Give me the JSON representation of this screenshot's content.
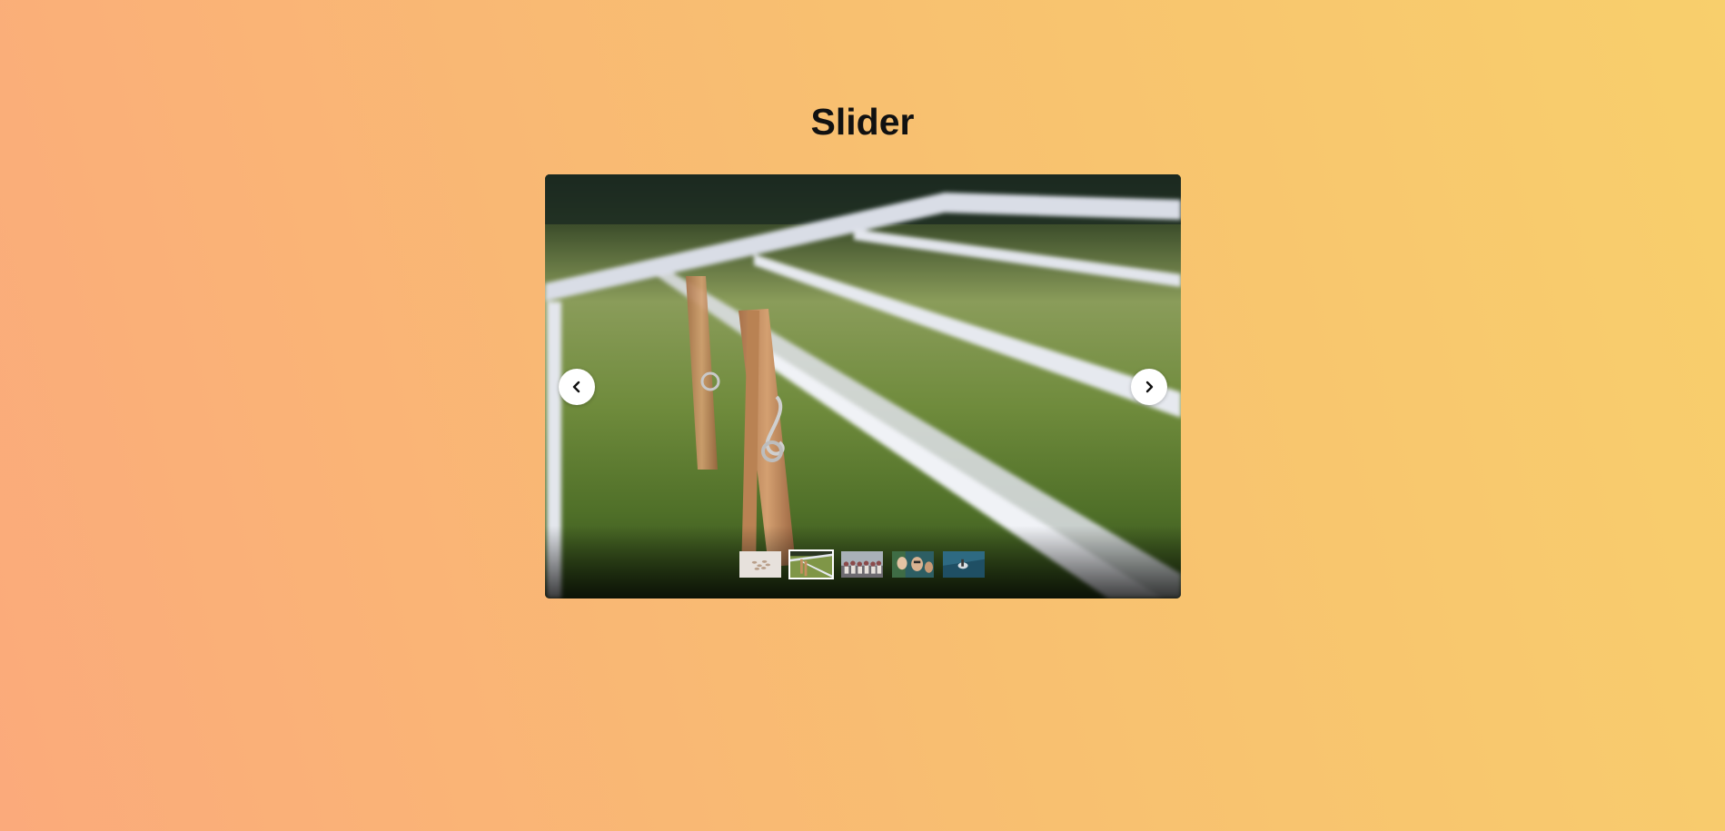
{
  "page": {
    "title": "Slider"
  },
  "slider": {
    "active_index": 1,
    "slide_count": 5,
    "current_slide_icon": "clothespins-on-drying-rack-photo",
    "prev_icon": "chevron-left-icon",
    "next_icon": "chevron-right-icon",
    "thumbnails": [
      {
        "icon": "scattered-pins-photo-thumbnail"
      },
      {
        "icon": "clothespins-on-drying-rack-photo-thumbnail"
      },
      {
        "icon": "crowd-photo-thumbnail"
      },
      {
        "icon": "portrait-photo-thumbnail"
      },
      {
        "icon": "water-scene-photo-thumbnail"
      }
    ]
  },
  "colors": {
    "background_start": "#fbaa7b",
    "background_end": "#f8cf6c",
    "title": "#111111",
    "nav_button": "#ffffff",
    "active_thumb_border": "#ffffff"
  }
}
